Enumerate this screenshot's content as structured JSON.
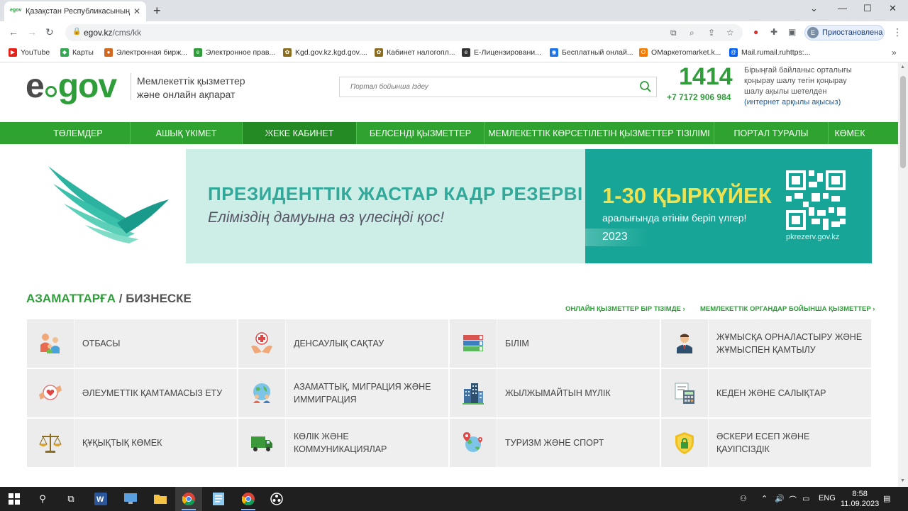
{
  "browser": {
    "tab_title": "Қазақстан Республикасының Эл",
    "favicon_text": "egov",
    "new_tab": "+",
    "minimize": "⌄",
    "url_domain": "egov.kz",
    "url_path": "/cms/kk",
    "profile_initial": "E",
    "profile_label": "Приостановлена"
  },
  "bookmarks": [
    {
      "label": "YouTube",
      "color": "#e62117",
      "glyph": "▶"
    },
    {
      "label": "Карты",
      "color": "#34a853",
      "glyph": "◆"
    },
    {
      "label": "Электронная бирж...",
      "color": "#d2691e",
      "glyph": "●"
    },
    {
      "label": "Электронное прав...",
      "color": "#2f9e3a",
      "glyph": "e"
    },
    {
      "label": "Kgd.gov.kz.kgd.gov....",
      "color": "#8a6d1f",
      "glyph": "✿"
    },
    {
      "label": "Кабинет налогопл...",
      "color": "#8a6d1f",
      "glyph": "✿"
    },
    {
      "label": "Е-Лицензировани...",
      "color": "#333333",
      "glyph": "e"
    },
    {
      "label": "Бесплатный онлай...",
      "color": "#1a73e8",
      "glyph": "◉"
    },
    {
      "label": "ОМаркетоmarket.k...",
      "color": "#f57c00",
      "glyph": "O"
    },
    {
      "label": "Mail.rumail.ruhttps:...",
      "color": "#005ff9",
      "glyph": "@"
    }
  ],
  "header": {
    "logo_e": "e",
    "logo_gov": "gov",
    "tagline_line1": "Мемлекеттік қызметтер",
    "tagline_line2": "және онлайн ақпарат",
    "search_placeholder": "Портал бойынша Іздеу",
    "hotline_number": "1414",
    "phone": "+7 7172 906 984",
    "hotline_desc_text": "Бірыңғай байланыс орталығы қоңырау шалу тегін қоңырау шалу ақылы шетелден",
    "hotline_desc_link": "(интернет арқылы ақысыз)"
  },
  "nav": [
    {
      "label": "ТӨЛЕМДЕР",
      "active": false
    },
    {
      "label": "АШЫҚ ҮКІМЕТ",
      "active": false
    },
    {
      "label": "ЖЕКЕ КАБИНЕТ",
      "active": true
    },
    {
      "label": "БЕЛСЕНДІ ҚЫЗМЕТТЕР",
      "active": false
    },
    {
      "label": "МЕМЛЕКЕТТІК КӨРСЕТІЛЕТІН ҚЫЗМЕТТЕР ТІЗІЛІМІ",
      "active": false
    },
    {
      "label": "ПОРТАЛ ТУРАЛЫ",
      "active": false
    },
    {
      "label": "КӨМЕК",
      "active": false
    }
  ],
  "banner": {
    "headline": "ПРЕЗИДЕНТТІК ЖАСТАР КАДР РЕЗЕРВІ",
    "subline": "Еліміздің дамуына өз үлесіңді қос!",
    "date": "1-30 ҚЫРКҮЙЕК",
    "date_sub": "аралығында өтінім беріп үлгер!",
    "year": "2023",
    "qr_url": "pkrezerv.gov.kz"
  },
  "section": {
    "title_green": "АЗАМАТТАРҒА",
    "title_sep": " / ",
    "title_rest": "БИЗНЕСКЕ",
    "link_online": "ОНЛАЙН ҚЫЗМЕТТЕР БІР ТІЗІМДЕ ›",
    "link_agencies": "МЕМЛЕКЕТТІК ОРГАНДАР БОЙЫНША ҚЫЗМЕТТЕР ›"
  },
  "categories": [
    {
      "label": "ОТБАСЫ",
      "icon": "family-icon"
    },
    {
      "label": "ДЕНСАУЛЫҚ САҚТАУ",
      "icon": "health-icon"
    },
    {
      "label": "БІЛІМ",
      "icon": "books-icon"
    },
    {
      "label": "ЖҰМЫСҚА ОРНАЛАСТЫРУ ЖӘНЕ ЖҰМЫСПЕН ҚАМТЫЛУ",
      "icon": "worker-icon"
    },
    {
      "label": "ӘЛЕУМЕТТІК ҚАМТАМАСЫЗ ЕТУ",
      "icon": "social-care-icon"
    },
    {
      "label": "АЗАМАТТЫҚ, МИГРАЦИЯ ЖӘНЕ ИММИГРАЦИЯ",
      "icon": "globe-people-icon"
    },
    {
      "label": "ЖЫЛЖЫМАЙТЫН МҮЛІК",
      "icon": "buildings-icon"
    },
    {
      "label": "КЕДЕН ЖӘНЕ САЛЫҚТАР",
      "icon": "calculator-icon"
    },
    {
      "label": "ҚҰҚЫҚТЫҚ КӨМЕК",
      "icon": "scales-icon"
    },
    {
      "label": "КӨЛІК ЖӘНЕ КОММУНИКАЦИЯЛАР",
      "icon": "truck-icon"
    },
    {
      "label": "ТУРИЗМ ЖӘНЕ СПОРТ",
      "icon": "travel-globe-icon"
    },
    {
      "label": "ӘСКЕРИ ЕСЕП ЖӘНЕ ҚАУІПСІЗДІК",
      "icon": "shield-lock-icon"
    }
  ],
  "taskbar": {
    "lang": "ENG",
    "time": "8:58",
    "date": "11.09.2023"
  }
}
